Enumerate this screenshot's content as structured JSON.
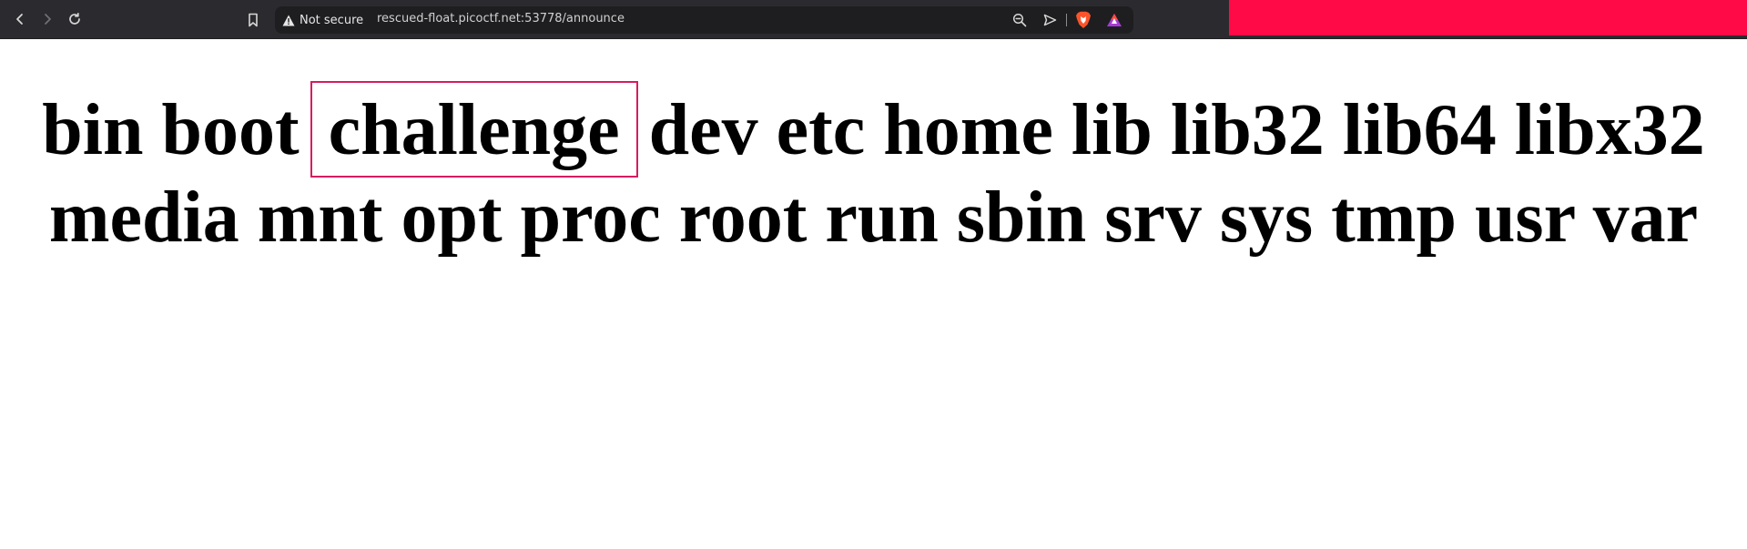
{
  "browser": {
    "security_label": "Not secure",
    "url": "rescued-float.picoctf.net:53778/announce",
    "icons": {
      "back": "back-arrow-icon",
      "forward": "forward-arrow-icon",
      "reload": "reload-icon",
      "bookmark": "bookmark-icon",
      "warning": "warning-triangle-icon",
      "zoom": "zoom-out-icon",
      "send": "send-icon",
      "shield": "brave-shield-icon",
      "rewards": "brave-rewards-icon"
    },
    "accent_color": "#ff0a47"
  },
  "page": {
    "words": [
      "bin",
      "boot",
      "challenge",
      "dev",
      "etc",
      "home",
      "lib",
      "lib32",
      "lib64",
      "libx32",
      "media",
      "mnt",
      "opt",
      "proc",
      "root",
      "run",
      "sbin",
      "srv",
      "sys",
      "tmp",
      "usr",
      "var"
    ],
    "highlighted_word": "challenge",
    "highlight_color": "#d81b60"
  }
}
